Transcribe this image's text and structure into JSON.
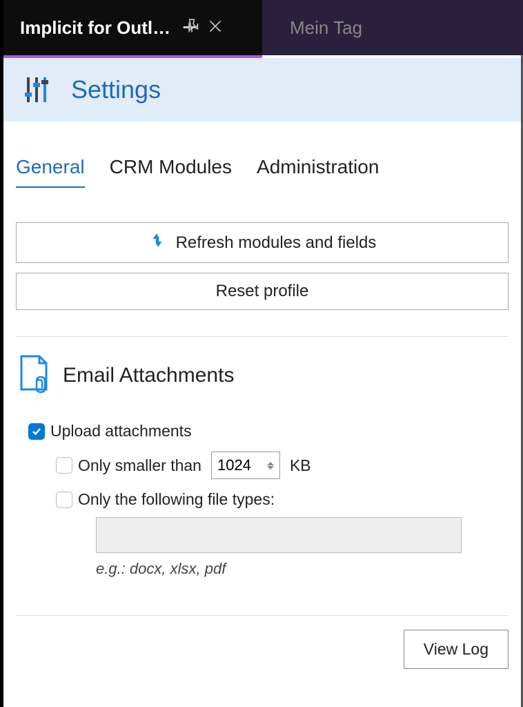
{
  "windowTabs": {
    "active": {
      "title": "Implicit for Outl…"
    },
    "inactive": {
      "title": "Mein Tag"
    }
  },
  "page": {
    "title": "Settings"
  },
  "tabs": {
    "general": "General",
    "crm": "CRM Modules",
    "admin": "Administration"
  },
  "actions": {
    "refresh": "Refresh modules and fields",
    "reset": "Reset profile"
  },
  "emailAttachments": {
    "title": "Email Attachments",
    "upload": {
      "label": "Upload attachments",
      "checked": true
    },
    "smaller": {
      "label": "Only smaller than",
      "value": "1024",
      "unit": "KB",
      "checked": false
    },
    "fileTypes": {
      "label": "Only the following file types:",
      "value": "",
      "checked": false,
      "hint": "e.g.: docx, xlsx, pdf"
    }
  },
  "footer": {
    "viewLog": "View Log"
  }
}
